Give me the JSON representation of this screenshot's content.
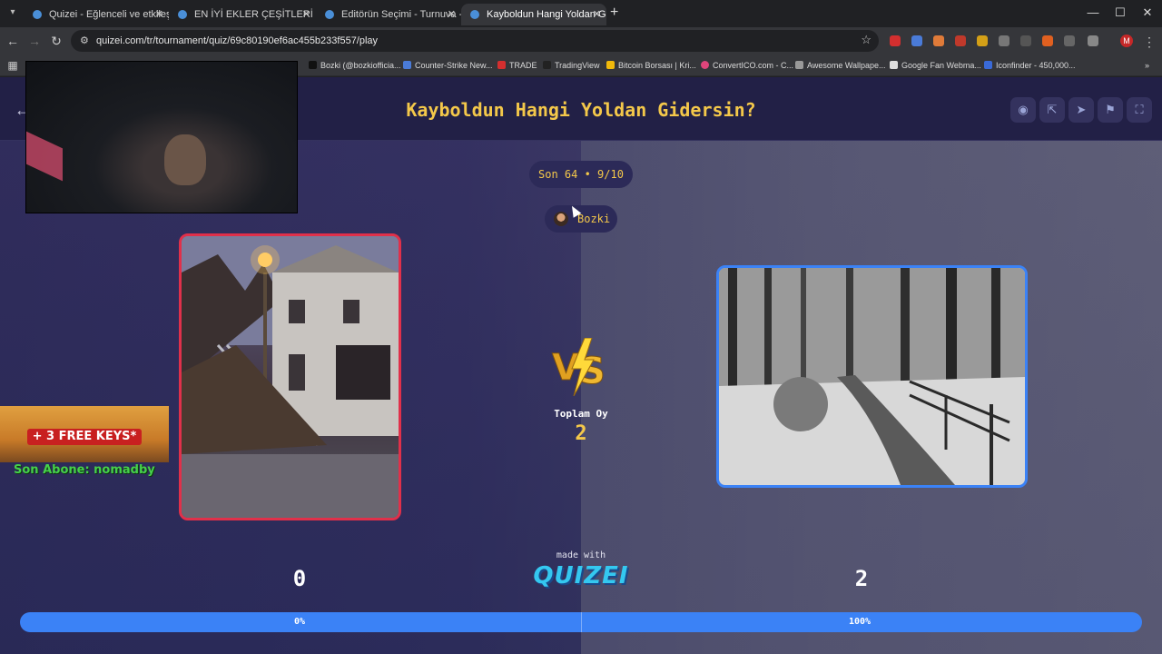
{
  "browser": {
    "tabs": [
      {
        "title": "Quizei - Eğlenceli ve etkileşimli",
        "active": false
      },
      {
        "title": "EN İYİ EKLER ÇEŞİTLERİ - Tier Li",
        "active": false
      },
      {
        "title": "Editörün Seçimi - Turnuva - Qu",
        "active": false
      },
      {
        "title": "Kayboldun Hangi Yoldan Gidersi",
        "active": true
      }
    ],
    "url": "quizei.com/tr/tournament/quiz/69c80190ef6ac455b233f557/play",
    "profile_initial": "M",
    "bookmarks": [
      "Bozki (@bozkiofficia...",
      "Counter-Strike New...",
      "TRADE",
      "TradingView",
      "Bitcoin Borsası | Kri...",
      "ConvertICO.com - C...",
      "Awesome Wallpape...",
      "Google Fan Webma...",
      "Iconfinder - 450,000..."
    ]
  },
  "quiz": {
    "title": "Kayboldun Hangi Yoldan Gidersin?",
    "round": "Son 64 • 9/10",
    "author": "Bozki",
    "total_votes_label": "Toplam Oy",
    "total_votes": "2",
    "left_score": "0",
    "right_score": "2",
    "left_percent": "0%",
    "right_percent": "100%",
    "left_share": 0,
    "right_share": 1,
    "made_with": "made with",
    "logo": "QUIZEI"
  },
  "overlay": {
    "promo": "+ 3 FREE KEYS*",
    "last_sub": "Son Abone: nomadby"
  },
  "colors": {
    "accent": "#f4c84a",
    "left_border": "#e0304a",
    "right_border": "#3b82f6",
    "progress": "#3b82f6"
  }
}
